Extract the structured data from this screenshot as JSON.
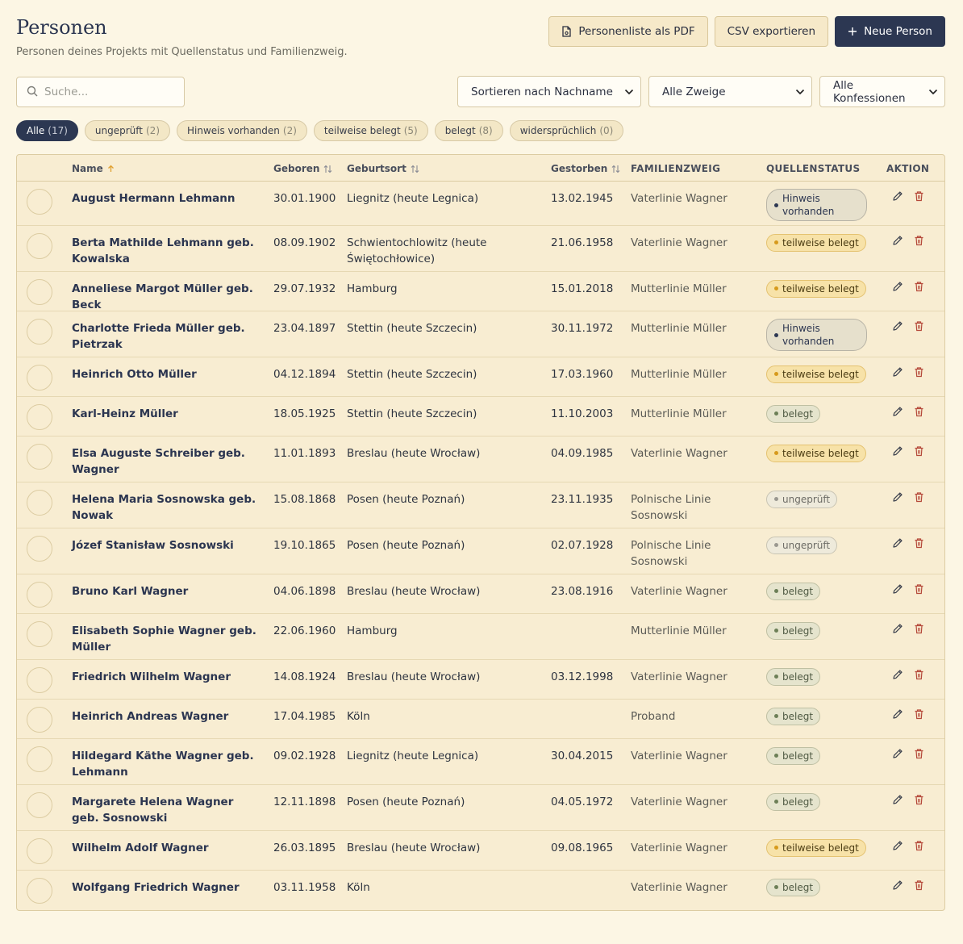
{
  "header": {
    "title": "Personen",
    "subtitle": "Personen deines Projekts mit Quellenstatus und Familienzweig.",
    "pdf_label": "Personenliste als PDF",
    "csv_label": "CSV exportieren",
    "new_label": "Neue Person"
  },
  "search": {
    "placeholder": "Suche..."
  },
  "filters": {
    "sort": "Sortieren nach Nachname",
    "branch": "Alle Zweige",
    "confession": "Alle Konfessionen"
  },
  "chips": [
    {
      "label": "Alle",
      "count": "(17)"
    },
    {
      "label": "ungeprüft",
      "count": "(2)"
    },
    {
      "label": "Hinweis vorhanden",
      "count": "(2)"
    },
    {
      "label": "teilweise belegt",
      "count": "(5)"
    },
    {
      "label": "belegt",
      "count": "(8)"
    },
    {
      "label": "widersprüchlich",
      "count": "(0)"
    }
  ],
  "columns": {
    "name": "Name",
    "born": "Geboren",
    "place": "Geburtsort",
    "died": "Gestorben",
    "branch": "FAMILIENZWEIG",
    "status": "QUELLENSTATUS",
    "action": "AKTION"
  },
  "rows": [
    {
      "name": "August Hermann Lehmann",
      "born": "30.01.1900",
      "place": "Liegnitz (heute Legnica)",
      "died": "13.02.1945",
      "branch": "Vaterlinie Wagner",
      "status": "Hinweis vorhanden"
    },
    {
      "name": "Berta Mathilde Lehmann geb. Kowalska",
      "born": "08.09.1902",
      "place": "Schwientochlowitz (heute Świętochłowice)",
      "died": "21.06.1958",
      "branch": "Vaterlinie Wagner",
      "status": "teilweise belegt"
    },
    {
      "name": "Anneliese Margot Müller geb. Beck",
      "born": "29.07.1932",
      "place": "Hamburg",
      "died": "15.01.2018",
      "branch": "Mutterlinie Müller",
      "status": "teilweise belegt"
    },
    {
      "name": "Charlotte Frieda Müller geb. Pietrzak",
      "born": "23.04.1897",
      "place": "Stettin (heute Szczecin)",
      "died": "30.11.1972",
      "branch": "Mutterlinie Müller",
      "status": "Hinweis vorhanden"
    },
    {
      "name": "Heinrich Otto Müller",
      "born": "04.12.1894",
      "place": "Stettin (heute Szczecin)",
      "died": "17.03.1960",
      "branch": "Mutterlinie Müller",
      "status": "teilweise belegt"
    },
    {
      "name": "Karl-Heinz Müller",
      "born": "18.05.1925",
      "place": "Stettin (heute Szczecin)",
      "died": "11.10.2003",
      "branch": "Mutterlinie Müller",
      "status": "belegt"
    },
    {
      "name": "Elsa Auguste Schreiber geb. Wagner",
      "born": "11.01.1893",
      "place": "Breslau (heute Wrocław)",
      "died": "04.09.1985",
      "branch": "Vaterlinie Wagner",
      "status": "teilweise belegt"
    },
    {
      "name": "Helena Maria Sosnowska geb. Nowak",
      "born": "15.08.1868",
      "place": "Posen (heute Poznań)",
      "died": "23.11.1935",
      "branch": "Polnische Linie Sosnowski",
      "status": "ungeprüft"
    },
    {
      "name": "Józef Stanisław Sosnowski",
      "born": "19.10.1865",
      "place": "Posen (heute Poznań)",
      "died": "02.07.1928",
      "branch": "Polnische Linie Sosnowski",
      "status": "ungeprüft"
    },
    {
      "name": "Bruno Karl Wagner",
      "born": "04.06.1898",
      "place": "Breslau (heute Wrocław)",
      "died": "23.08.1916",
      "branch": "Vaterlinie Wagner",
      "status": "belegt"
    },
    {
      "name": "Elisabeth Sophie Wagner geb. Müller",
      "born": "22.06.1960",
      "place": "Hamburg",
      "died": "",
      "branch": "Mutterlinie Müller",
      "status": "belegt"
    },
    {
      "name": "Friedrich Wilhelm Wagner",
      "born": "14.08.1924",
      "place": "Breslau (heute Wrocław)",
      "died": "03.12.1998",
      "branch": "Vaterlinie Wagner",
      "status": "belegt"
    },
    {
      "name": "Heinrich Andreas Wagner",
      "born": "17.04.1985",
      "place": "Köln",
      "died": "",
      "branch": "Proband",
      "status": "belegt"
    },
    {
      "name": "Hildegard Käthe Wagner geb. Lehmann",
      "born": "09.02.1928",
      "place": "Liegnitz (heute Legnica)",
      "died": "30.04.2015",
      "branch": "Vaterlinie Wagner",
      "status": "belegt"
    },
    {
      "name": "Margarete Helena Wagner geb. Sosnowski",
      "born": "12.11.1898",
      "place": "Posen (heute Poznań)",
      "died": "04.05.1972",
      "branch": "Vaterlinie Wagner",
      "status": "belegt"
    },
    {
      "name": "Wilhelm Adolf Wagner",
      "born": "26.03.1895",
      "place": "Breslau (heute Wrocław)",
      "died": "09.08.1965",
      "branch": "Vaterlinie Wagner",
      "status": "teilweise belegt"
    },
    {
      "name": "Wolfgang Friedrich Wagner",
      "born": "03.11.1958",
      "place": "Köln",
      "died": "",
      "branch": "Vaterlinie Wagner",
      "status": "belegt"
    }
  ],
  "icons": {
    "pdf": "file-pdf-icon",
    "new": "plus-icon",
    "search": "search-icon",
    "select": "chevron-down-icon",
    "sort_asc": "arrow-up-icon",
    "sort_both": "sort-icon",
    "edit": "pencil-icon",
    "delete": "trash-icon"
  },
  "colors": {
    "primary": "#2c3752",
    "background": "#fcf6e4",
    "delete": "#b5493a",
    "sort_active": "#e0a030"
  }
}
